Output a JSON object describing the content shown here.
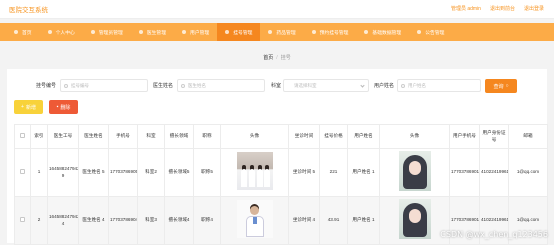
{
  "header": {
    "title": "医院交互系统",
    "links": [
      "管理员 admin",
      "退出到前台",
      "退出登录"
    ]
  },
  "nav": {
    "items": [
      {
        "label": "首页",
        "active": false
      },
      {
        "label": "个人中心",
        "active": false
      },
      {
        "label": "管理员管理",
        "active": false
      },
      {
        "label": "医生管理",
        "active": false
      },
      {
        "label": "用户管理",
        "active": false
      },
      {
        "label": "挂号管理",
        "active": true
      },
      {
        "label": "药品管理",
        "active": false
      },
      {
        "label": "预约挂号管理",
        "active": false
      },
      {
        "label": "基础数据管理",
        "active": false
      },
      {
        "label": "公告管理",
        "active": false
      }
    ]
  },
  "breadcrumb": {
    "home": "首页",
    "sep": "/",
    "current": "挂号"
  },
  "search": {
    "fields": [
      {
        "label": "挂号编号",
        "placeholder": "挂号编号"
      },
      {
        "label": "医生姓名",
        "placeholder": "医生姓名"
      },
      {
        "label": "科室",
        "placeholder": "请选择科室"
      },
      {
        "label": "用户姓名",
        "placeholder": "用户姓名"
      }
    ],
    "query_label": "查询"
  },
  "actions": {
    "add_label": "新增",
    "delete_label": "删除"
  },
  "table": {
    "columns": [
      "",
      "索引",
      "医生工号",
      "医生姓名",
      "手机号",
      "科室",
      "擅长领域",
      "职称",
      "头像",
      "坐诊时间",
      "挂号价格",
      "用户姓名",
      "头像",
      "用户手机号",
      "用户身份证号",
      "邮箱"
    ],
    "rows": [
      {
        "index": "1",
        "doctor_no": "16458824794231 9",
        "doctor_name": "医生姓名 5",
        "phone": "17703786905",
        "dept": "科室2",
        "specialty": "擅长领域5",
        "title": "职称5",
        "doctor_photo": "nurses",
        "visit_time": "坐诊时间 5",
        "price": "221",
        "user_name": "用户姓名 1",
        "user_avatar": "anime-girl",
        "user_phone": "17703786901",
        "user_id": "410224199610232001",
        "email": "1@qq.com"
      },
      {
        "index": "2",
        "doctor_no": "16458824794231 4",
        "doctor_name": "医生姓名 4",
        "phone": "17703786904",
        "dept": "科室3",
        "specialty": "擅长领域4",
        "title": "职称4",
        "doctor_photo": "doctor",
        "visit_time": "坐诊时间 4",
        "price": "43.91",
        "user_name": "用户姓名 1",
        "user_avatar": "anime-girl",
        "user_phone": "17703786901",
        "user_id": "410224199610232001",
        "email": "1@qq.com"
      }
    ]
  },
  "watermark": "CSDN @wx_chen_q123456",
  "colors": {
    "accent": "#f5871f",
    "nav_bg": "#fcab47",
    "add": "#f8d23a",
    "delete": "#ee5a36"
  }
}
